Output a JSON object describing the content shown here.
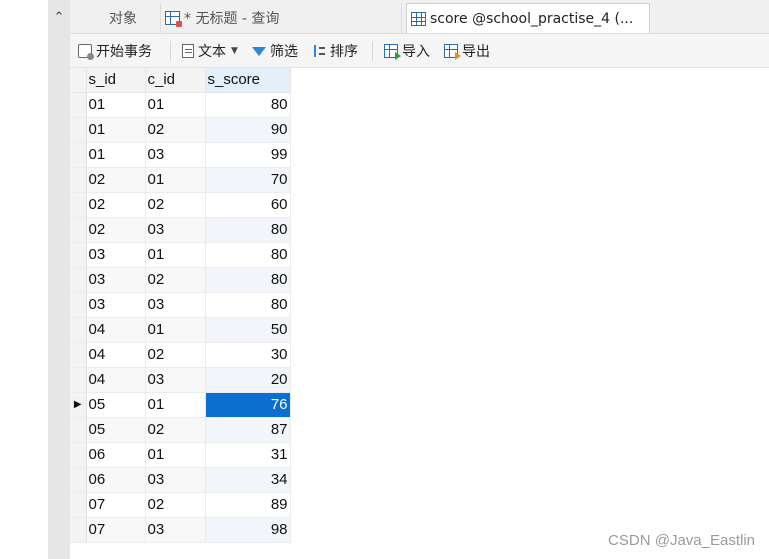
{
  "tabs": {
    "objects": "对象",
    "query": "* 无标题 - 查询",
    "table": "score @school_practise_4 (..."
  },
  "toolbar": {
    "begin_transaction": "开始事务",
    "text": "文本",
    "filter": "筛选",
    "sort": "排序",
    "import": "导入",
    "export": "导出"
  },
  "grid": {
    "columns": [
      "s_id",
      "c_id",
      "s_score"
    ],
    "rows": [
      [
        "01",
        "01",
        "80"
      ],
      [
        "01",
        "02",
        "90"
      ],
      [
        "01",
        "03",
        "99"
      ],
      [
        "02",
        "01",
        "70"
      ],
      [
        "02",
        "02",
        "60"
      ],
      [
        "02",
        "03",
        "80"
      ],
      [
        "03",
        "01",
        "80"
      ],
      [
        "03",
        "02",
        "80"
      ],
      [
        "03",
        "03",
        "80"
      ],
      [
        "04",
        "01",
        "50"
      ],
      [
        "04",
        "02",
        "30"
      ],
      [
        "04",
        "03",
        "20"
      ],
      [
        "05",
        "01",
        "76"
      ],
      [
        "05",
        "02",
        "87"
      ],
      [
        "06",
        "01",
        "31"
      ],
      [
        "06",
        "03",
        "34"
      ],
      [
        "07",
        "02",
        "89"
      ],
      [
        "07",
        "03",
        "98"
      ]
    ],
    "current_row_index": 12,
    "current_row_marker": "▶",
    "selection_color": "#0a6fce"
  },
  "watermark": "CSDN @Java_Eastlin"
}
